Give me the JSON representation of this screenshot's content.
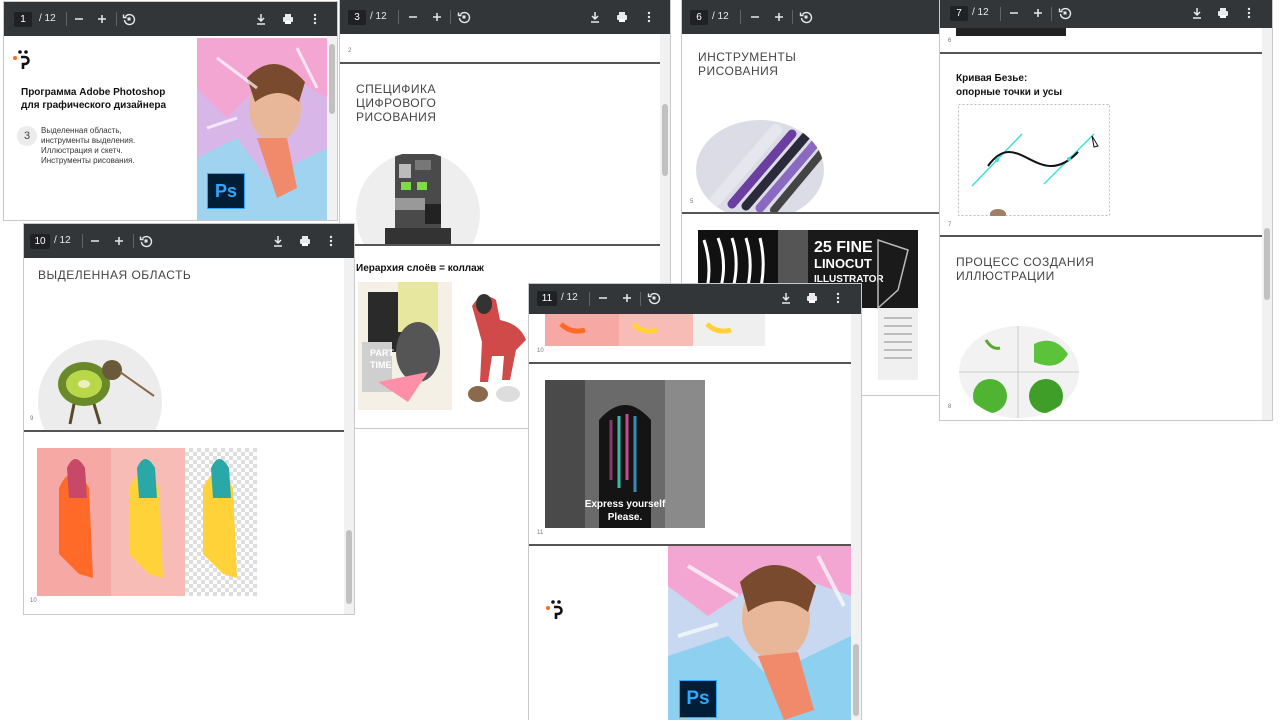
{
  "windows": {
    "w1": {
      "page": "1",
      "total": "/ 12"
    },
    "w3": {
      "page": "3",
      "total": "/ 12"
    },
    "w6": {
      "page": "6",
      "total": "/ 12"
    },
    "w7": {
      "page": "7",
      "total": "/ 12"
    },
    "w10": {
      "page": "10",
      "total": "/ 12"
    },
    "w11": {
      "page": "11",
      "total": "/ 12"
    }
  },
  "slides": {
    "title_line1": "Программа Adobe Photoshop",
    "title_line2": "для графического дизайнера",
    "lesson_number": "3",
    "lesson_desc": [
      "Выделенная область,",
      "инструменты выделения.",
      "Иллюстрация и скетч.",
      "Инструменты рисования."
    ],
    "ps_label": "Ps",
    "spec_title": [
      "СПЕЦИФИКА",
      "ЦИФРОВОГО",
      "РИСОВАНИЯ"
    ],
    "layers_title": "Иерархия слоёв = коллаж",
    "tools_title": [
      "ИНСТРУМЕНТЫ",
      "РИСОВАНИЯ"
    ],
    "bezier_title": [
      "Кривая Безье:",
      "опорные точки и усы"
    ],
    "process_title": [
      "ПРОЦЕСС СОЗДАНИЯ",
      "ИЛЛЮСТРАЦИИ"
    ],
    "selection_title": "ВЫДЕЛЕННАЯ ОБЛАСТЬ",
    "express_line1": "Express yourself",
    "express_line2": "Please.",
    "linocut": [
      "25 FINE",
      "LINOCUT",
      "ILLUSTRATOR"
    ],
    "collage_text": [
      "PART",
      "TIME"
    ],
    "page_numbers": {
      "p2": "2",
      "p5": "5",
      "p6": "6",
      "p7": "7",
      "p8": "8",
      "p9": "9",
      "p10": "10",
      "p11": "11"
    }
  },
  "colors": {
    "toolbar": "#323639",
    "ps_bg": "#001e36",
    "ps_fg": "#31a8ff",
    "bezier_handle": "#3ee0d8",
    "logo_dot": "#ff6a1a"
  }
}
